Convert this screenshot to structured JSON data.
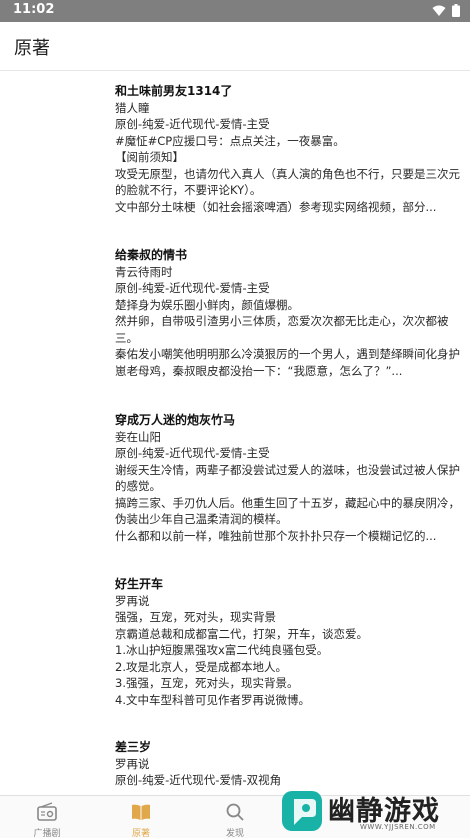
{
  "status_bar": {
    "time": "11:02"
  },
  "app_bar": {
    "title": "原著"
  },
  "books": [
    {
      "title": "和土味前男友1314了",
      "author": "猎人瞳",
      "tags": "原创-纯爱-近代现代-爱情-主受",
      "lines": [
        "#魔怔#CP应援口号：点点关注，一夜暴富。",
        "【阅前须知】",
        "攻受无原型，也请勿代入真人（真人演的角色也不行，只要是三次元的脸就不行，不要评论KY）。",
        "文中部分土味梗（如社会摇滚啤酒）参考现实网络视频，部分..."
      ]
    },
    {
      "title": "给秦叔的情书",
      "author": "青云待雨时",
      "tags": "原创-纯爱-近代现代-爱情-主受",
      "lines": [
        "楚择身为娱乐圈小鲜肉，颜值爆棚。",
        "然并卵，自带吸引渣男小三体质，恋爱次次都无比走心，次次都被三。",
        "秦佑发小嘲笑他明明那么冷漠狠厉的一个男人，遇到楚绎瞬间化身护崽老母鸡，秦叔眼皮都没抬一下：“我愿意，怎么了？”..."
      ]
    },
    {
      "title": "穿成万人迷的炮灰竹马",
      "author": "妾在山阳",
      "tags": "原创-纯爱-近代现代-爱情-主受",
      "lines": [
        "谢绥天生冷情，两辈子都没尝试过爱人的滋味，也没尝试过被人保护的感觉。",
        "搞跨三家、手刃仇人后。他重生回了十五岁，藏起心中的暴戾阴冷，伪装出少年自己温柔清润的模样。",
        "什么都和以前一样，唯独前世那个灰扑扑只存一个模糊记忆的..."
      ]
    },
    {
      "title": "好生开车",
      "author": "罗再说",
      "tags": "强强，互宠，死对头，现实背景",
      "lines": [
        "京霸道总裁和成都富二代，打架，开车，谈恋爱。",
        "1.冰山护短腹黑强攻x富二代纯良骚包受。",
        "2.攻是北京人，受是成都本地人。",
        "3.强强，互宠，死对头，现实背景。",
        "4.文中车型科普可见作者罗再说微博。"
      ]
    },
    {
      "title": "差三岁",
      "author": "罗再说",
      "tags": "原创-纯爱-近代现代-爱情-双视角",
      "lines": []
    }
  ],
  "tabs": [
    {
      "label": "广播剧",
      "icon": "radio-icon",
      "active": false
    },
    {
      "label": "原著",
      "icon": "book-icon",
      "active": true
    },
    {
      "label": "发现",
      "icon": "search-icon",
      "active": false
    }
  ],
  "watermark": {
    "brand": "幽静游戏",
    "url": "WWW.YJJSREN.COM"
  },
  "colors": {
    "active_tab": "#e0a84a",
    "status_bar": "#7f7f7f",
    "logo_teal": "#18b3a6"
  }
}
